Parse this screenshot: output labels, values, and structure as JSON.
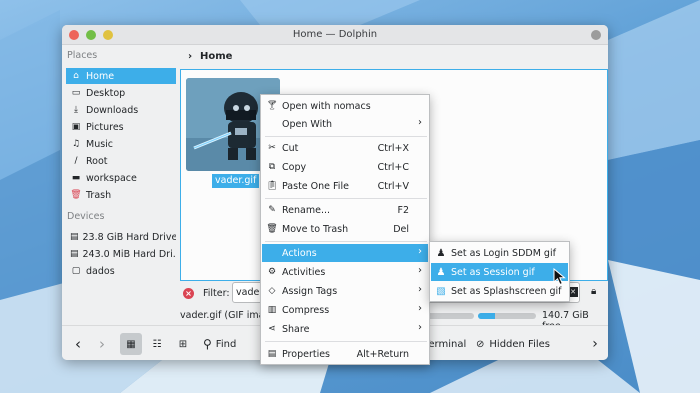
{
  "window": {
    "title": "Home — Dolphin"
  },
  "sidebar": {
    "places_header": "Places",
    "places": [
      {
        "label": "Home",
        "icon": "home-icon",
        "selected": true
      },
      {
        "label": "Desktop",
        "icon": "desktop-icon"
      },
      {
        "label": "Downloads",
        "icon": "downloads-icon"
      },
      {
        "label": "Pictures",
        "icon": "pictures-icon"
      },
      {
        "label": "Music",
        "icon": "music-icon"
      },
      {
        "label": "Root",
        "icon": "root-icon"
      },
      {
        "label": "workspace",
        "icon": "folder-icon"
      },
      {
        "label": "Trash",
        "icon": "trash-icon"
      }
    ],
    "devices_header": "Devices",
    "devices": [
      {
        "label": "23.8 GiB Hard Drive",
        "icon": "harddrive-icon"
      },
      {
        "label": "243.0 MiB Hard Dri...",
        "icon": "harddrive-icon"
      },
      {
        "label": "dados",
        "icon": "harddrive-icon"
      }
    ]
  },
  "breadcrumb": {
    "current": "Home"
  },
  "view": {
    "file_name": "vader.gif"
  },
  "filter": {
    "label": "Filter:",
    "value": "vader"
  },
  "status": {
    "text": "vader.gif (GIF image",
    "free": "140.7 GiB free",
    "used_fraction": 0.3
  },
  "toolbar": {
    "find_label": "Find",
    "terminal_label": "Terminal",
    "hidden_files_label": "Hidden Files"
  },
  "context_menu": {
    "items": [
      {
        "label": "Open with nomacs",
        "icon": "nomacs-icon"
      },
      {
        "label": "Open With",
        "submenu": true
      },
      {
        "label": "Cut",
        "icon": "cut-icon",
        "shortcut": "Ctrl+X"
      },
      {
        "label": "Copy",
        "icon": "copy-icon",
        "shortcut": "Ctrl+C"
      },
      {
        "label": "Paste One File",
        "icon": "paste-icon",
        "shortcut": "Ctrl+V"
      },
      {
        "label": "Rename...",
        "icon": "rename-icon",
        "shortcut": "F2"
      },
      {
        "label": "Move to Trash",
        "icon": "trash-icon",
        "shortcut": "Del"
      },
      {
        "label": "Actions",
        "submenu": true,
        "active": true
      },
      {
        "label": "Activities",
        "icon": "activities-icon",
        "submenu": true
      },
      {
        "label": "Assign Tags",
        "icon": "tag-icon",
        "submenu": true
      },
      {
        "label": "Compress",
        "icon": "compress-icon",
        "submenu": true
      },
      {
        "label": "Share",
        "icon": "share-icon",
        "submenu": true
      },
      {
        "label": "Properties",
        "icon": "properties-icon",
        "shortcut": "Alt+Return"
      }
    ]
  },
  "actions_submenu": {
    "items": [
      {
        "label": "Set as Login SDDM gif",
        "icon": "user-icon"
      },
      {
        "label": "Set as Session gif",
        "icon": "user-icon",
        "active": true
      },
      {
        "label": "Set as Splashscreen gif",
        "icon": "image-icon"
      }
    ]
  },
  "colors": {
    "accent": "#3daee9",
    "window_bg": "#eff0f1",
    "close": "#ed655a"
  }
}
